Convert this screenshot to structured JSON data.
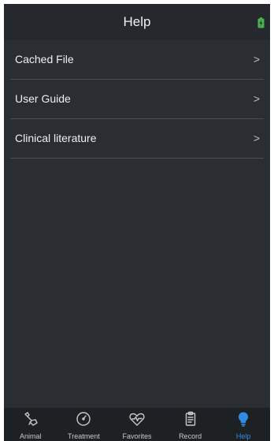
{
  "header": {
    "title": "Help",
    "battery_icon": "battery-charging-icon",
    "battery_color": "#4caf50"
  },
  "menu": {
    "items": [
      {
        "label": "Cached File",
        "icon": "chevron-right-icon",
        "chevron": ">"
      },
      {
        "label": "User Guide",
        "icon": "chevron-right-icon",
        "chevron": ">"
      },
      {
        "label": "Clinical literature",
        "icon": "chevron-right-icon",
        "chevron": ">"
      }
    ]
  },
  "tabbar": {
    "tabs": [
      {
        "label": "Animal",
        "icon": "animal-icon",
        "active": false
      },
      {
        "label": "Treatment",
        "icon": "treatment-clock-icon",
        "active": false
      },
      {
        "label": "Favorites",
        "icon": "favorites-heart-icon",
        "active": false
      },
      {
        "label": "Record",
        "icon": "record-clipboard-icon",
        "active": false
      },
      {
        "label": "Help",
        "icon": "help-bulb-icon",
        "active": true
      }
    ],
    "active_color": "#2f8de4",
    "inactive_color": "#c8c8c8"
  },
  "colors": {
    "background": "#2a2d31",
    "header_background": "#25282c",
    "tabbar_background": "#1e2124",
    "divider": "#4a4d52"
  }
}
